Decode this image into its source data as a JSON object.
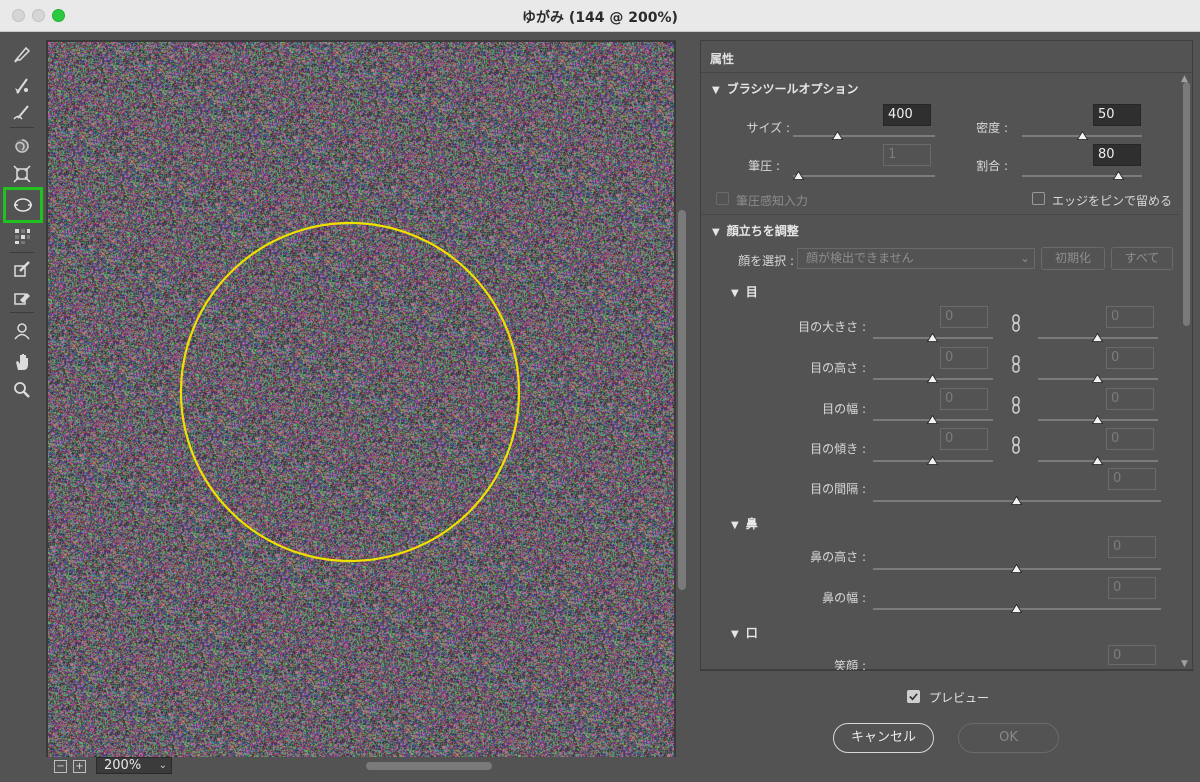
{
  "window": {
    "title": "ゆがみ (144 @ 200%)"
  },
  "tools": [
    {
      "name": "forward-warp-tool-icon"
    },
    {
      "name": "reconstruct-tool-icon"
    },
    {
      "name": "smooth-tool-icon"
    },
    {
      "name": "twirl-tool-icon"
    },
    {
      "name": "pucker-tool-icon"
    },
    {
      "name": "face-tool-icon"
    },
    {
      "name": "push-left-tool-icon"
    },
    {
      "name": "freeze-mask-tool-icon"
    },
    {
      "name": "thaw-mask-tool-icon"
    },
    {
      "name": "face-select-tool-icon"
    },
    {
      "name": "hand-tool-icon"
    },
    {
      "name": "zoom-tool-icon"
    }
  ],
  "canvas": {
    "zoom_minus": "−",
    "zoom_plus": "+",
    "zoom_value": "200%",
    "brush_circle_color": "#f0e000"
  },
  "panel": {
    "title": "属性",
    "brush_section": {
      "title": "ブラシツールオプション",
      "size_label": "サイズ :",
      "size_value": "400",
      "size_level": 0.31,
      "density_label": "密度 :",
      "density_value": "50",
      "density_level": 0.5,
      "pressure_label": "筆圧 :",
      "pressure_value": "1",
      "pressure_level": 0.0,
      "rate_label": "割合 :",
      "rate_value": "80",
      "rate_level": 0.8,
      "stylus_pressure_label": "筆圧感知入力",
      "pin_edges_label": "エッジをピンで留める"
    },
    "face_section": {
      "title": "顔立ちを調整",
      "select_face_label": "顔を選択 :",
      "select_face_value": "顔が検出できません",
      "reset_button": "初期化",
      "all_button": "すべて",
      "eyes": {
        "title": "目",
        "size_label": "目の大きさ :",
        "height_label": "目の高さ :",
        "width_label": "目の幅 :",
        "tilt_label": "目の傾き :",
        "distance_label": "目の間隔 :",
        "value": "0"
      },
      "nose": {
        "title": "鼻",
        "height_label": "鼻の高さ :",
        "width_label": "鼻の幅 :",
        "value": "0"
      },
      "mouth": {
        "title": "口",
        "smile_label": "笑顔 :",
        "value": "0"
      }
    }
  },
  "footer": {
    "preview_label": "プレビュー",
    "cancel_label": "キャンセル",
    "ok_label": "OK"
  }
}
